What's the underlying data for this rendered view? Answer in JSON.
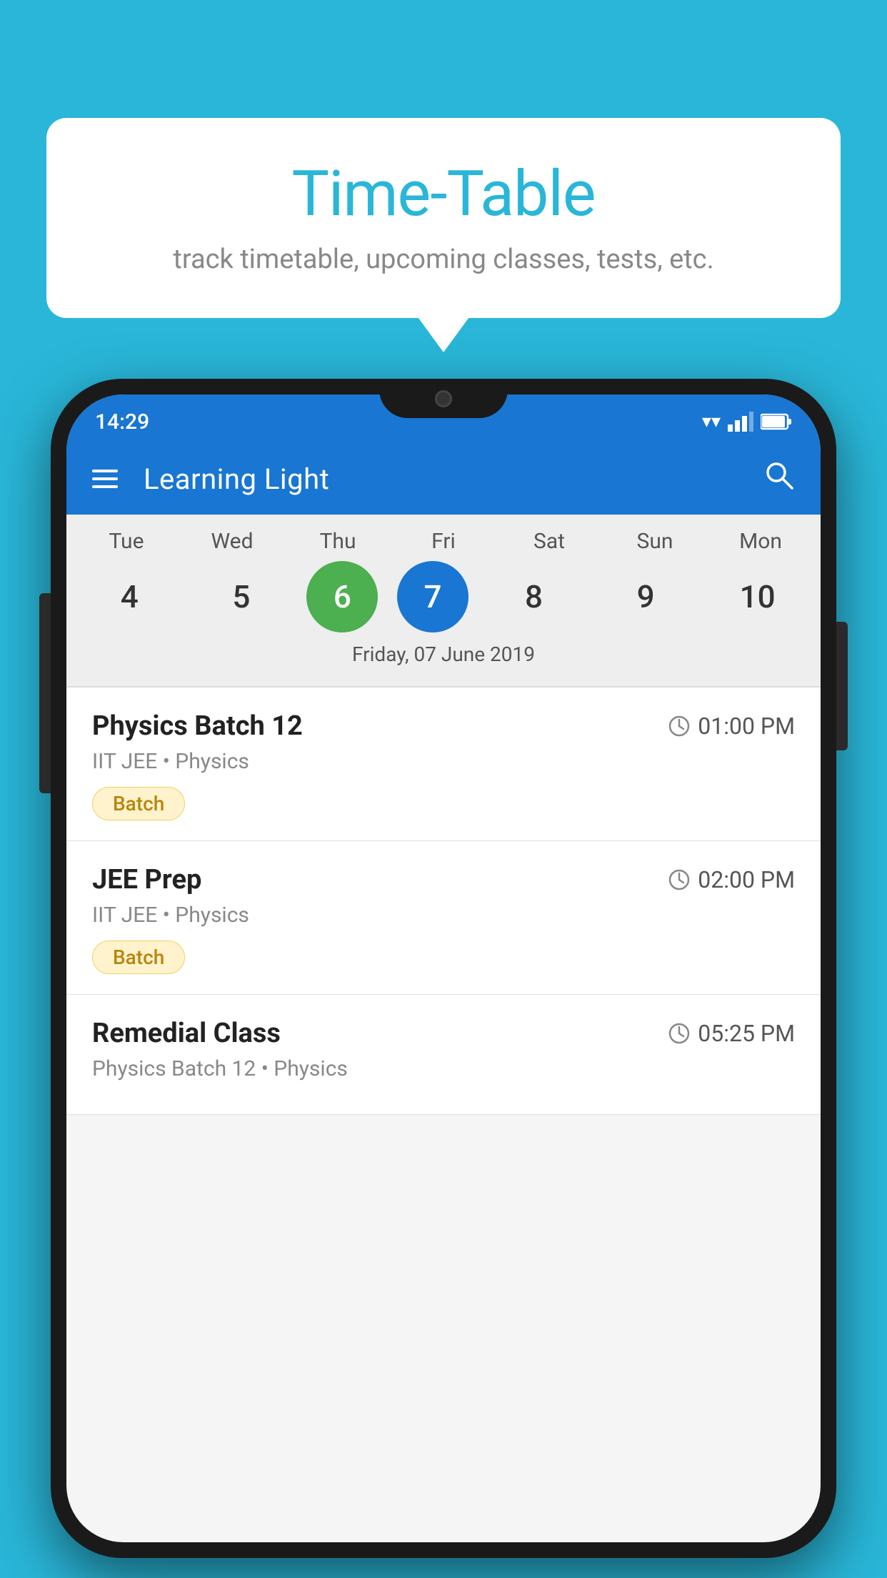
{
  "page": {
    "background_color": "#29b6d8"
  },
  "bubble": {
    "title": "Time-Table",
    "subtitle": "track timetable, upcoming classes, tests, etc."
  },
  "phone": {
    "status_bar": {
      "time": "14:29"
    },
    "app_bar": {
      "title": "Learning Light"
    },
    "calendar": {
      "days": [
        {
          "label": "Tue",
          "num": "4"
        },
        {
          "label": "Wed",
          "num": "5"
        },
        {
          "label": "Thu",
          "num": "6",
          "state": "today"
        },
        {
          "label": "Fri",
          "num": "7",
          "state": "selected"
        },
        {
          "label": "Sat",
          "num": "8"
        },
        {
          "label": "Sun",
          "num": "9"
        },
        {
          "label": "Mon",
          "num": "10"
        }
      ],
      "selected_date": "Friday, 07 June 2019"
    },
    "schedule": [
      {
        "title": "Physics Batch 12",
        "time": "01:00 PM",
        "subtitle": "IIT JEE • Physics",
        "tag": "Batch"
      },
      {
        "title": "JEE Prep",
        "time": "02:00 PM",
        "subtitle": "IIT JEE • Physics",
        "tag": "Batch"
      },
      {
        "title": "Remedial Class",
        "time": "05:25 PM",
        "subtitle": "Physics Batch 12 • Physics",
        "tag": ""
      }
    ]
  }
}
